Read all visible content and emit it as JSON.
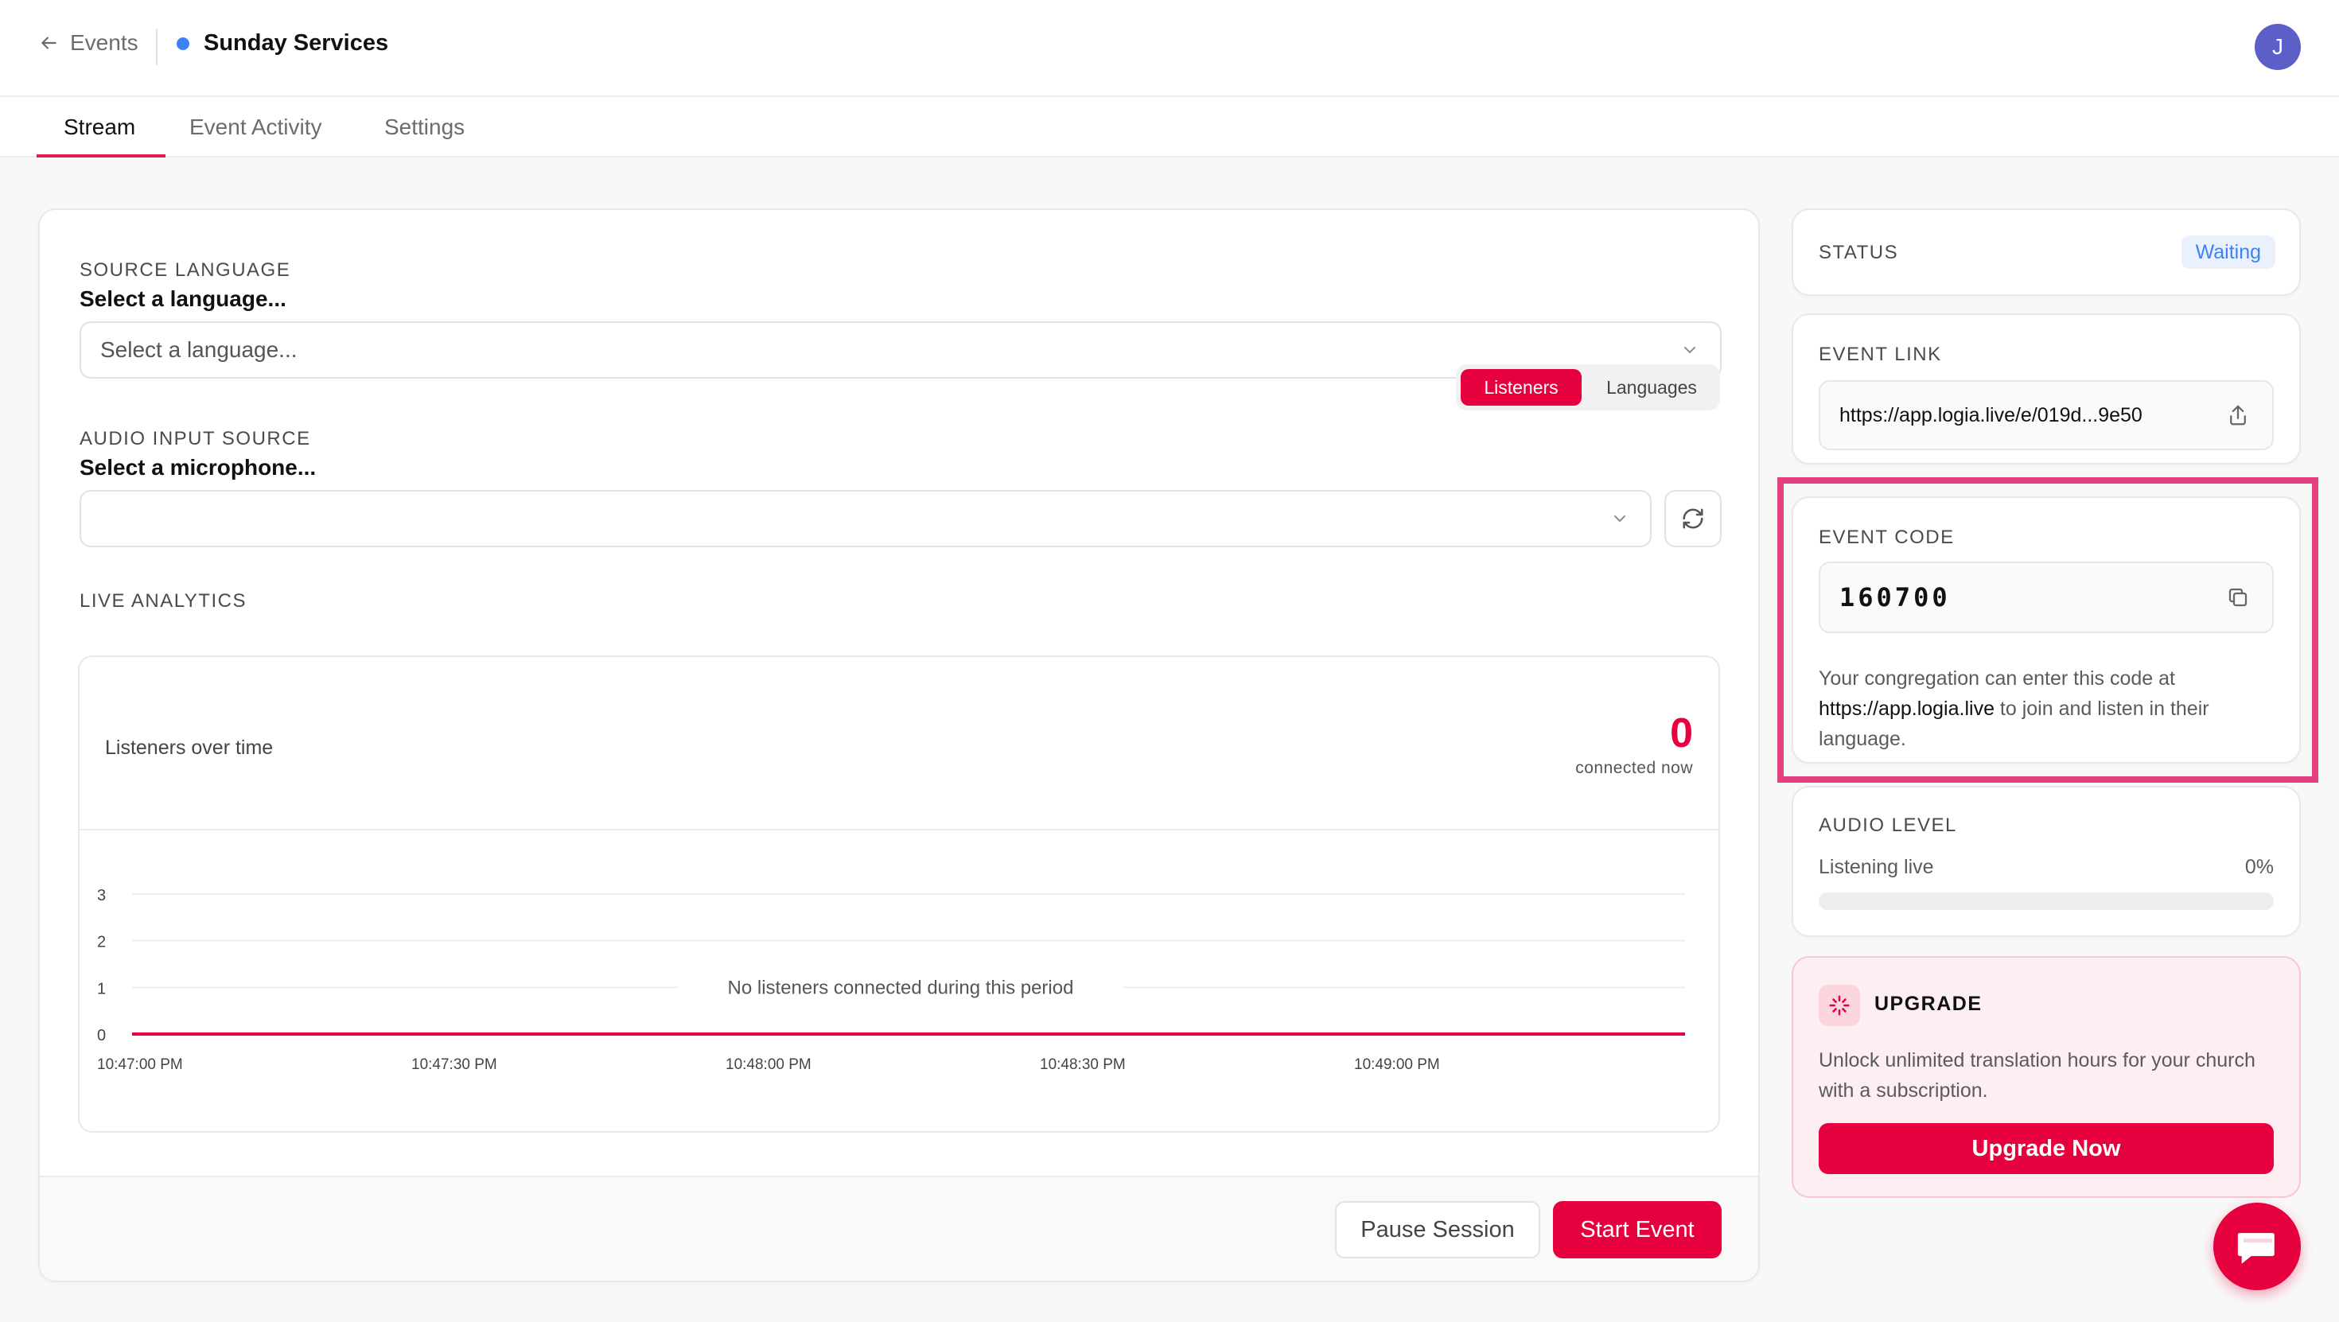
{
  "header": {
    "back_label": "Events",
    "event_title": "Sunday Services",
    "avatar_initial": "J"
  },
  "tabs": [
    {
      "label": "Stream",
      "active": true
    },
    {
      "label": "Event Activity",
      "active": false
    },
    {
      "label": "Settings",
      "active": false
    }
  ],
  "source_language": {
    "label": "SOURCE LANGUAGE",
    "sublabel": "Select a language...",
    "select_value": "Select a language..."
  },
  "audio_input": {
    "label": "AUDIO INPUT SOURCE",
    "sublabel": "Select a microphone...",
    "select_value": ""
  },
  "live_analytics": {
    "label": "LIVE ANALYTICS",
    "toggle": [
      "Listeners",
      "Languages"
    ],
    "active_toggle": "Listeners"
  },
  "listeners_panel": {
    "title": "Listeners over time",
    "count": "0",
    "count_caption": "connected now",
    "empty_message": "No listeners connected during this period"
  },
  "chart_data": {
    "type": "line",
    "x": [
      "10:47:00 PM",
      "10:47:30 PM",
      "10:48:00 PM",
      "10:48:30 PM",
      "10:49:00 PM"
    ],
    "series": [
      {
        "values": [
          0,
          0,
          0,
          0,
          0
        ]
      }
    ],
    "y_ticks": [
      "0",
      "1",
      "2",
      "3"
    ],
    "ylim": [
      0,
      3
    ],
    "grid": true,
    "line_color": "#e6003d"
  },
  "footer": {
    "pause_label": "Pause Session",
    "start_label": "Start Event"
  },
  "status": {
    "label": "STATUS",
    "value": "Waiting"
  },
  "event_link": {
    "label": "EVENT LINK",
    "url": "https://app.logia.live/e/019d...9e50"
  },
  "event_code": {
    "label": "EVENT CODE",
    "code": "160700",
    "desc_before": "Your congregation can enter this code at ",
    "desc_link": "https://app.logia.live",
    "desc_after": " to join and listen in their language."
  },
  "audio_level": {
    "label": "AUDIO LEVEL",
    "status_text": "Listening live",
    "percent_text": "0%",
    "level": 0
  },
  "upgrade": {
    "title": "UPGRADE",
    "desc": "Unlock unlimited translation hours for your church with a subscription.",
    "button_label": "Upgrade Now"
  },
  "colors": {
    "accent": "#e6003d",
    "status_blue": "#3b82f6",
    "highlight": "#e5407e"
  }
}
